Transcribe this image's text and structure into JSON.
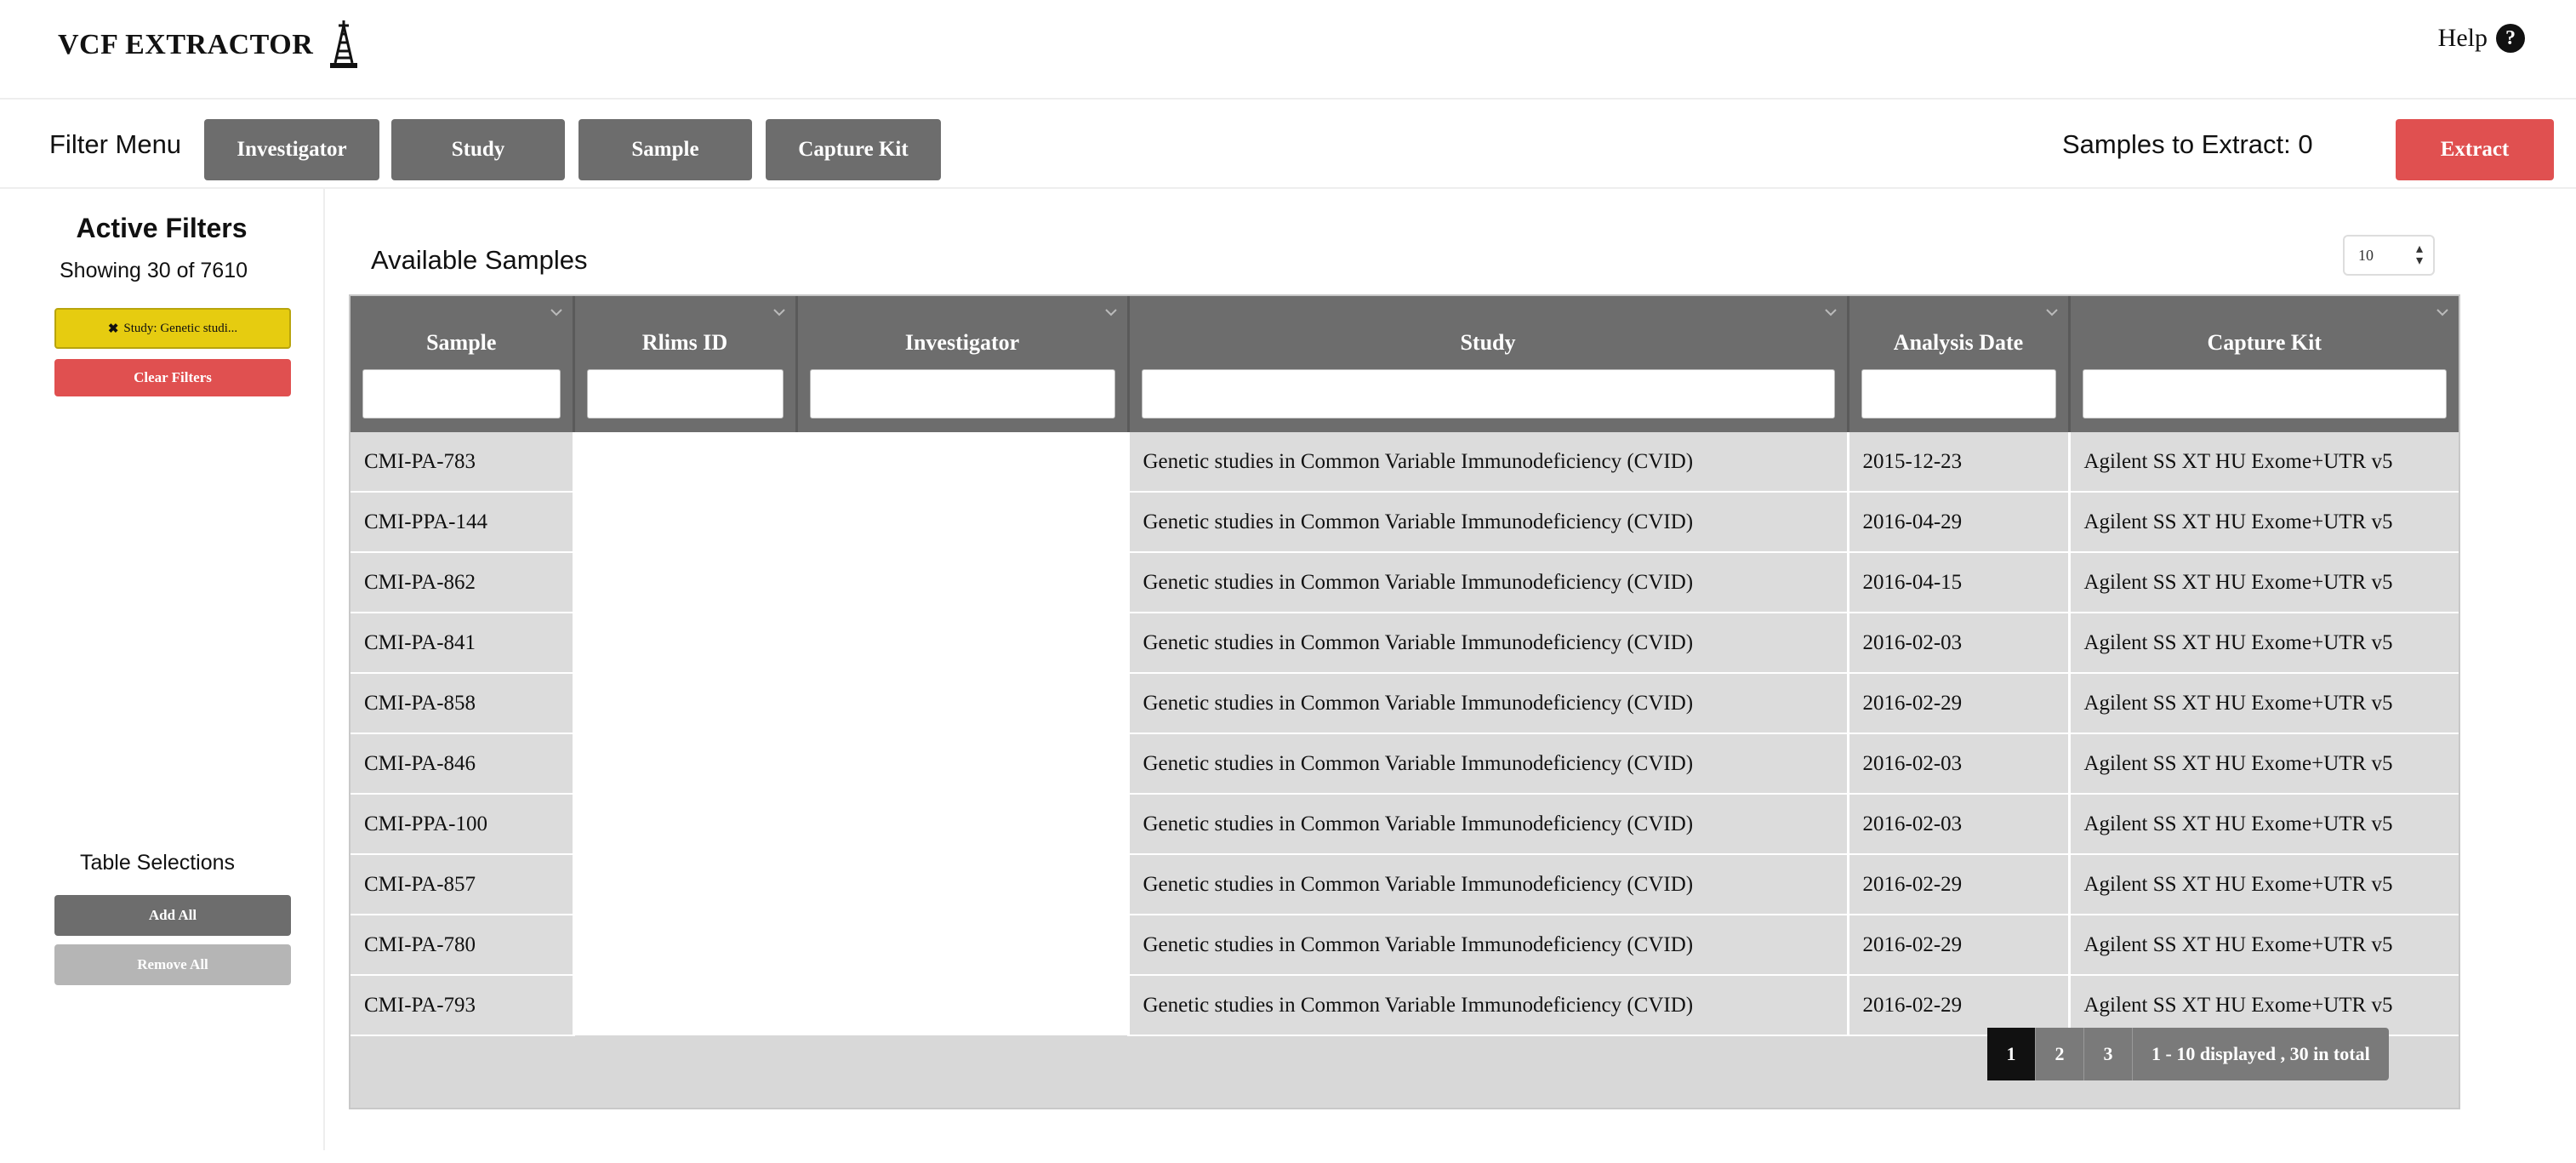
{
  "header": {
    "title": "VCF EXTRACTOR",
    "help_label": "Help"
  },
  "filter_menu": {
    "label": "Filter Menu",
    "buttons": [
      "Investigator",
      "Study",
      "Sample",
      "Capture Kit"
    ],
    "samples_to_extract": "Samples to Extract: 0",
    "extract_label": "Extract"
  },
  "sidebar": {
    "active_filters_title": "Active Filters",
    "showing": "Showing 30 of 7610",
    "filter_chip": "Study: Genetic studi...",
    "clear_filters": "Clear Filters",
    "table_selections_title": "Table Selections",
    "add_all": "Add All",
    "remove_all": "Remove All"
  },
  "main": {
    "title": "Available Samples",
    "page_size": "10",
    "columns": [
      "Sample",
      "Rlims ID",
      "Investigator",
      "Study",
      "Analysis Date",
      "Capture Kit"
    ],
    "rows": [
      [
        "CMI-PA-783",
        "",
        "",
        "Genetic studies in Common Variable Immunodeficiency (CVID)",
        "2015-12-23",
        "Agilent SS XT HU Exome+UTR v5"
      ],
      [
        "CMI-PPA-144",
        "",
        "",
        "Genetic studies in Common Variable Immunodeficiency (CVID)",
        "2016-04-29",
        "Agilent SS XT HU Exome+UTR v5"
      ],
      [
        "CMI-PA-862",
        "",
        "",
        "Genetic studies in Common Variable Immunodeficiency (CVID)",
        "2016-04-15",
        "Agilent SS XT HU Exome+UTR v5"
      ],
      [
        "CMI-PA-841",
        "",
        "",
        "Genetic studies in Common Variable Immunodeficiency (CVID)",
        "2016-02-03",
        "Agilent SS XT HU Exome+UTR v5"
      ],
      [
        "CMI-PA-858",
        "",
        "",
        "Genetic studies in Common Variable Immunodeficiency (CVID)",
        "2016-02-29",
        "Agilent SS XT HU Exome+UTR v5"
      ],
      [
        "CMI-PA-846",
        "",
        "",
        "Genetic studies in Common Variable Immunodeficiency (CVID)",
        "2016-02-03",
        "Agilent SS XT HU Exome+UTR v5"
      ],
      [
        "CMI-PPA-100",
        "",
        "",
        "Genetic studies in Common Variable Immunodeficiency (CVID)",
        "2016-02-03",
        "Agilent SS XT HU Exome+UTR v5"
      ],
      [
        "CMI-PA-857",
        "",
        "",
        "Genetic studies in Common Variable Immunodeficiency (CVID)",
        "2016-02-29",
        "Agilent SS XT HU Exome+UTR v5"
      ],
      [
        "CMI-PA-780",
        "",
        "",
        "Genetic studies in Common Variable Immunodeficiency (CVID)",
        "2016-02-29",
        "Agilent SS XT HU Exome+UTR v5"
      ],
      [
        "CMI-PA-793",
        "",
        "",
        "Genetic studies in Common Variable Immunodeficiency (CVID)",
        "2016-02-29",
        "Agilent SS XT HU Exome+UTR v5"
      ]
    ],
    "pagination": {
      "pages": [
        "1",
        "2",
        "3"
      ],
      "active": "1",
      "info": "1 - 10 displayed , 30 in total"
    }
  },
  "colors": {
    "header_gray": "#6d6d6d",
    "danger": "#e05050",
    "chip_yellow": "#e6cc10",
    "row_gray": "#dcdcdc"
  }
}
